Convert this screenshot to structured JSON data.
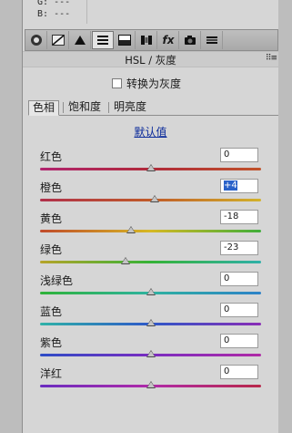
{
  "readout": {
    "g_label": "G:",
    "g_value": "---",
    "b_label": "B:",
    "b_value": "---"
  },
  "toolbar": {
    "tools": [
      {
        "name": "basic-tool",
        "glyph": "◎"
      },
      {
        "name": "tone-curve-tool",
        "glyph": ""
      },
      {
        "name": "detail-tool",
        "glyph": "▲"
      },
      {
        "name": "hsl-grayscale-tool",
        "glyph": "≡"
      },
      {
        "name": "split-toning-tool",
        "glyph": "▤"
      },
      {
        "name": "lens-corrections-tool",
        "glyph": "▐▌"
      },
      {
        "name": "effects-tool",
        "glyph": "fx"
      },
      {
        "name": "camera-calibration-tool",
        "glyph": "■"
      },
      {
        "name": "presets-tool",
        "glyph": "☰"
      }
    ],
    "active_index": 3
  },
  "panel": {
    "title": "HSL / 灰度",
    "menu_glyph": "⠿≡"
  },
  "grayscale": {
    "label": "转换为灰度",
    "checked": false
  },
  "tabs": [
    {
      "label": "色相",
      "selected": true
    },
    {
      "label": "饱和度",
      "selected": false
    },
    {
      "label": "明亮度",
      "selected": false
    }
  ],
  "default_link": "默认值",
  "sliders": [
    {
      "label": "红色",
      "value": "0",
      "level": 0,
      "colors": [
        "#b0246f",
        "#b02a3a",
        "#c0522a"
      ]
    },
    {
      "label": "橙色",
      "value": "+4",
      "level": 4,
      "colors": [
        "#b0304b",
        "#c05a28",
        "#d2b22a"
      ]
    },
    {
      "label": "黄色",
      "value": "-18",
      "level": -18,
      "colors": [
        "#c04a2a",
        "#d6b824",
        "#3fae3a"
      ]
    },
    {
      "label": "绿色",
      "value": "-23",
      "level": -23,
      "colors": [
        "#b6a42a",
        "#35b236",
        "#2fb0a8"
      ]
    },
    {
      "label": "浅绿色",
      "value": "0",
      "level": 0,
      "colors": [
        "#2fb238",
        "#2fb2a0",
        "#2d82c8"
      ]
    },
    {
      "label": "蓝色",
      "value": "0",
      "level": 0,
      "colors": [
        "#2fb2a8",
        "#2d58c8",
        "#8a2cb6"
      ]
    },
    {
      "label": "紫色",
      "value": "0",
      "level": 0,
      "colors": [
        "#2d4cc6",
        "#7a2cc0",
        "#b02aa6"
      ]
    },
    {
      "label": "洋红",
      "value": "0",
      "level": 0,
      "colors": [
        "#6a2cc0",
        "#b02aa8",
        "#b8284a"
      ]
    }
  ]
}
